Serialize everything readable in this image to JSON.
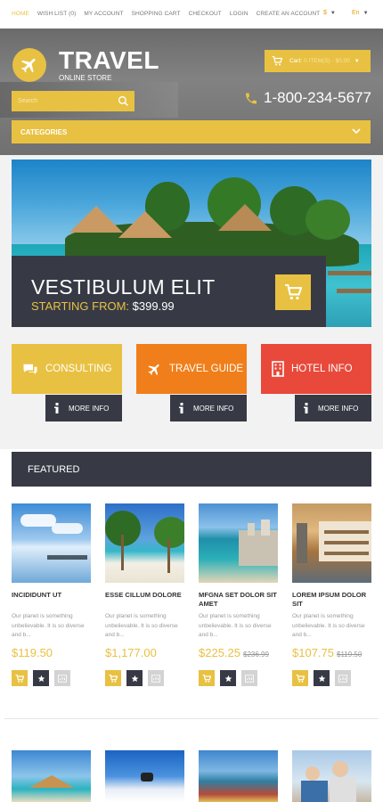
{
  "topnav": {
    "items": [
      {
        "label": "HOME"
      },
      {
        "label": "WISH LIST (0)"
      },
      {
        "label": "MY ACCOUNT"
      },
      {
        "label": "SHOPPING CART"
      },
      {
        "label": "CHECKOUT"
      },
      {
        "label": "LOGIN"
      },
      {
        "label": "CREATE AN ACCOUNT"
      }
    ],
    "currency": "$",
    "language": "En"
  },
  "header": {
    "logo_title": "TRAVEL",
    "logo_subtitle": "ONLINE STORE",
    "cart_label": "Cart:",
    "cart_value": "0 ITEM(S) - $0.00",
    "phone": "1-800-234-5677",
    "search_placeholder": "Search",
    "categories_label": "CATEGORIES"
  },
  "slider": {
    "title": "VESTIBULUM ELIT",
    "from_label": "STARTING FROM:",
    "price": "$399.99"
  },
  "info_blocks": [
    {
      "label": "CONSULTING",
      "icon": "chat-icon",
      "color": "#e8c142",
      "more": "MORE INFO"
    },
    {
      "label": "TRAVEL GUIDE",
      "icon": "plane-icon",
      "color": "#f07f1b",
      "more": "MORE INFO"
    },
    {
      "label": "HOTEL INFO",
      "icon": "building-icon",
      "color": "#e8493a",
      "more": "MORE INFO"
    }
  ],
  "featured": {
    "title": "FEATURED",
    "products": [
      {
        "name": "INCIDIDUNT UT",
        "desc": "Our planet is something unbelievable. It is so diverse and b...",
        "price": "$119.50",
        "old_price": ""
      },
      {
        "name": "ESSE CILLUM DOLORE",
        "desc": "Our planet is something unbelievable. It is so diverse and b...",
        "price": "$1,177.00",
        "old_price": ""
      },
      {
        "name": "MFGNA SET DOLOR SIT AMET",
        "desc": "Our planet is something unbelievable. It is so diverse and b...",
        "price": "$225.25",
        "old_price": "$236.99"
      },
      {
        "name": "LOREM IPSUM DOLOR SIT",
        "desc": "Our planet is something unbelievable. It is so diverse and b...",
        "price": "$107.75",
        "old_price": "$119.50"
      }
    ]
  },
  "colors": {
    "accent": "#e8c142",
    "dark": "#373a45",
    "orange": "#f07f1b",
    "red": "#e8493a"
  }
}
